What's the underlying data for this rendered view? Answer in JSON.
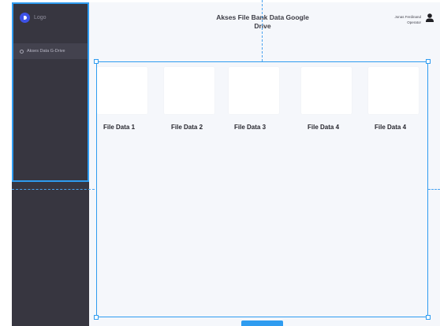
{
  "sidebar": {
    "logo_text": "Logo",
    "logo_icon": "logo-mark-icon",
    "menu_items": [
      {
        "label": "Akses Data G-Drive",
        "icon": "circle-outline-icon"
      }
    ]
  },
  "header": {
    "title": "Akses File Bank Data Google Drive",
    "user": {
      "name": "Jonas Ferdinand",
      "role": "Operator",
      "icon": "user-icon"
    }
  },
  "cards": [
    {
      "label": "File Data 1"
    },
    {
      "label": "File Data 2"
    },
    {
      "label": "File Data 3"
    },
    {
      "label": "File Data 4"
    },
    {
      "label": "File Data 4"
    }
  ],
  "overlay": {
    "size_label": "",
    "accent_color": "#2f9cf0"
  },
  "colors": {
    "sidebar_bg": "#373640",
    "sidebar_active_bg": "#43424e",
    "content_bg": "#f5f7fb",
    "logo_blue": "#3d52e6"
  }
}
